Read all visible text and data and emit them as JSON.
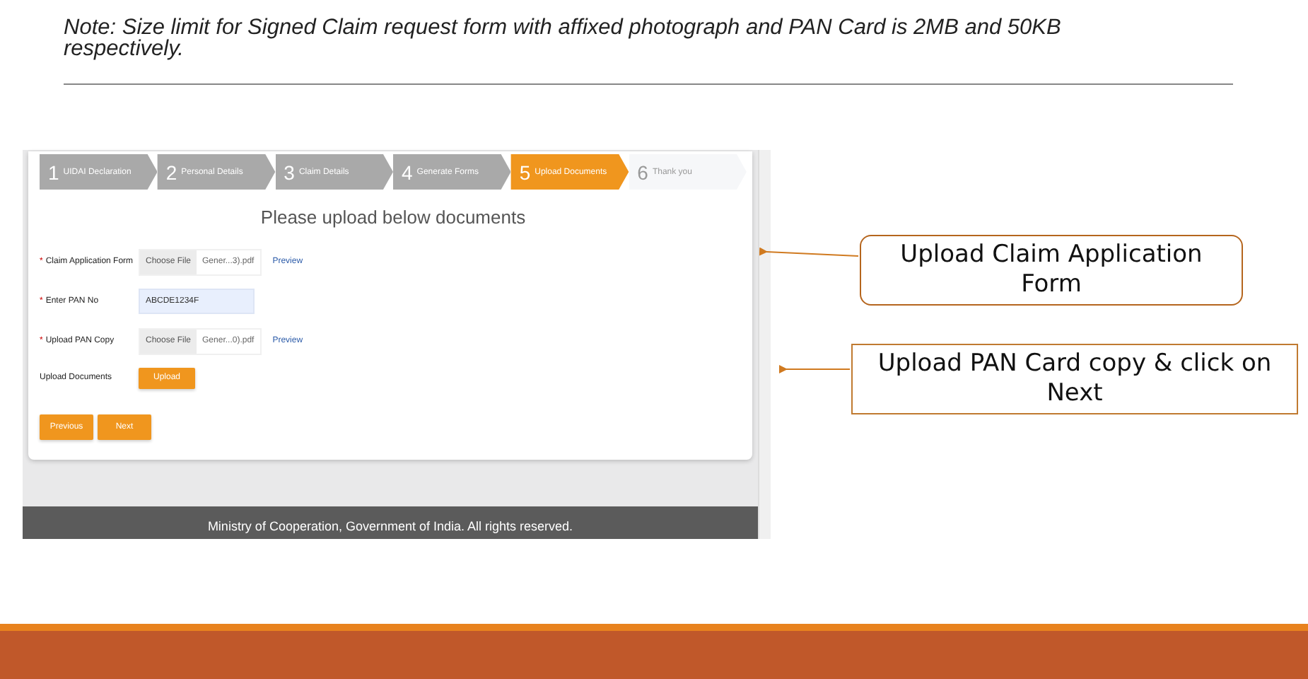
{
  "note": "Note:  Size limit for Signed Claim request form with affixed photograph and PAN Card is 2MB and 50KB respectively.",
  "screenshot": {
    "steps": [
      {
        "number": "1",
        "label": "UIDAI Declaration",
        "selected": false,
        "completed": true
      },
      {
        "number": "2",
        "label": "Personal Details",
        "selected": false,
        "completed": true
      },
      {
        "number": "3",
        "label": "Claim Details",
        "selected": false,
        "completed": true
      },
      {
        "number": "4",
        "label": "Generate Forms",
        "selected": false,
        "completed": true
      },
      {
        "number": "5",
        "label": "Upload Documents",
        "selected": true,
        "completed": false
      },
      {
        "number": "6",
        "label": "Thank you",
        "selected": false,
        "completed": false
      }
    ],
    "heading": "Please upload below documents",
    "fields": [
      {
        "kind": "file",
        "mark": "*",
        "label": "Claim Application Form",
        "button": "Choose File",
        "file": "Gener...3).pdf",
        "link": "Preview"
      },
      {
        "kind": "text",
        "mark": "*",
        "label": "Enter PAN No",
        "value": "ABCDE1234F"
      },
      {
        "kind": "file",
        "mark": "*",
        "label": "Upload PAN Copy",
        "button": "Choose File",
        "file": "Gener...0).pdf",
        "link": "Preview"
      },
      {
        "kind": "upload",
        "label": "Upload Documents",
        "button": "Upload"
      }
    ],
    "nav_buttons": [
      "Previous",
      "Next"
    ],
    "footer": "Ministry of Cooperation, Government of India. All rights reserved."
  },
  "callouts": [
    {
      "kind": "rounded",
      "text": "Upload Claim Application Form"
    },
    {
      "kind": "square",
      "text": "Upload PAN Card copy & click on Next"
    }
  ]
}
